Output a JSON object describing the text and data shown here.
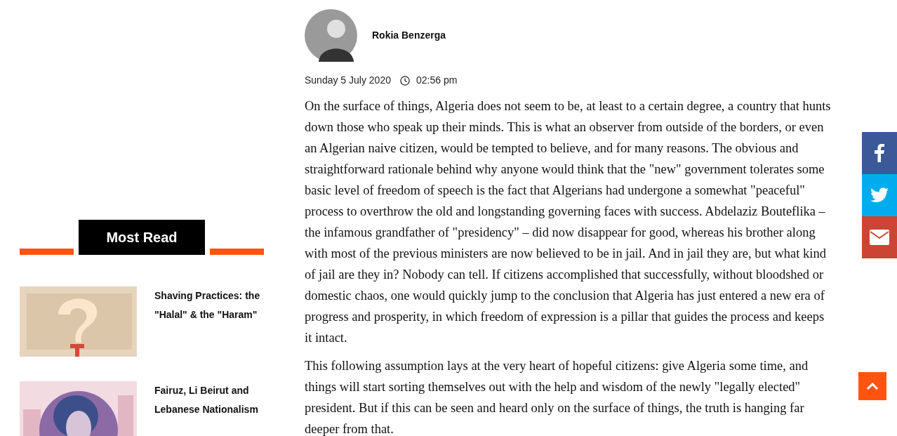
{
  "sidebar": {
    "heading": "Most Read",
    "items": [
      {
        "title": "Shaving Practices: the \"Halal\" & the \"Haram\"",
        "kind": "picture"
      },
      {
        "title": "Fairuz, Li Beirut and Lebanese Nationalism",
        "kind": "picture"
      }
    ]
  },
  "article": {
    "author": "Rokia Benzerga",
    "date": "Sunday 5 July 2020",
    "time": "02:56 pm",
    "paragraphs": [
      "On the surface of things, Algeria does not seem to be, at least to a certain degree, a country that hunts down those who speak up their minds. This is what an observer from outside of the borders, or even an Algerian naive citizen, would be tempted to believe, and for many reasons. The obvious and straightforward rationale behind why anyone would think that the \"new\" government tolerates some basic level of freedom of speech is the fact that Algerians had undergone a somewhat \"peaceful\" process to overthrow the old and longstanding governing faces with success. Abdelaziz Bouteflika – the infamous grandfather of \"presidency\" – did now disappear for good, whereas his brother along with most of the previous ministers are now believed to be in jail. And in jail they are, but what kind of jail are they in? Nobody can tell. If citizens accomplished that successfully, without bloodshed or domestic chaos, one would quickly jump to the conclusion that Algeria has just entered a new era of progress and prosperity, in which freedom of expression is a pillar that guides the process and keeps it intact.",
      "This following assumption lays at the very heart of hopeful citizens: give Algeria some time, and things will start sorting themselves out with the help and wisdom of the newly \"legally elected\" president. But if this can be seen and heard only on the surface of things, the truth is hanging far deeper from that."
    ]
  },
  "share_buttons": [
    {
      "kind": "facebook"
    },
    {
      "kind": "twitter"
    },
    {
      "kind": "email"
    }
  ]
}
